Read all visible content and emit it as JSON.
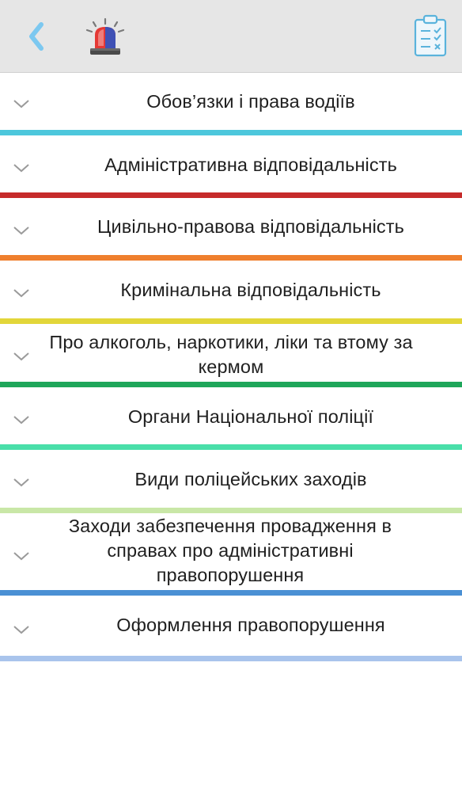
{
  "header": {
    "back_icon": "chevron-left-icon",
    "badge_icon": "police-siren-icon",
    "checklist_icon": "checklist-icon",
    "accent": "#45b8f0"
  },
  "categories": [
    {
      "label": "Обов’язки і права водіїв",
      "color": "#4dc7dc"
    },
    {
      "label": "Адміністративна відповідальність",
      "color": "#c62b2b"
    },
    {
      "label": "Цивільно-правова відповідальність",
      "color": "#ef7f2d"
    },
    {
      "label": "Кримінальна відповідальність",
      "color": "#e2d63a"
    },
    {
      "label": "Про алкоголь, наркотики, ліки та втому за кермом",
      "color": "#1ea65a"
    },
    {
      "label": "Органи Національної поліції",
      "color": "#49dfa9"
    },
    {
      "label": "Види поліцейських заходів",
      "color": "#c9e7a7"
    },
    {
      "label": "Заходи забезпечення провадження в справах про адміністративні правопорушення",
      "color": "#4a90d4"
    },
    {
      "label": "Оформлення правопорушення",
      "color": "#a9c4ec"
    }
  ]
}
